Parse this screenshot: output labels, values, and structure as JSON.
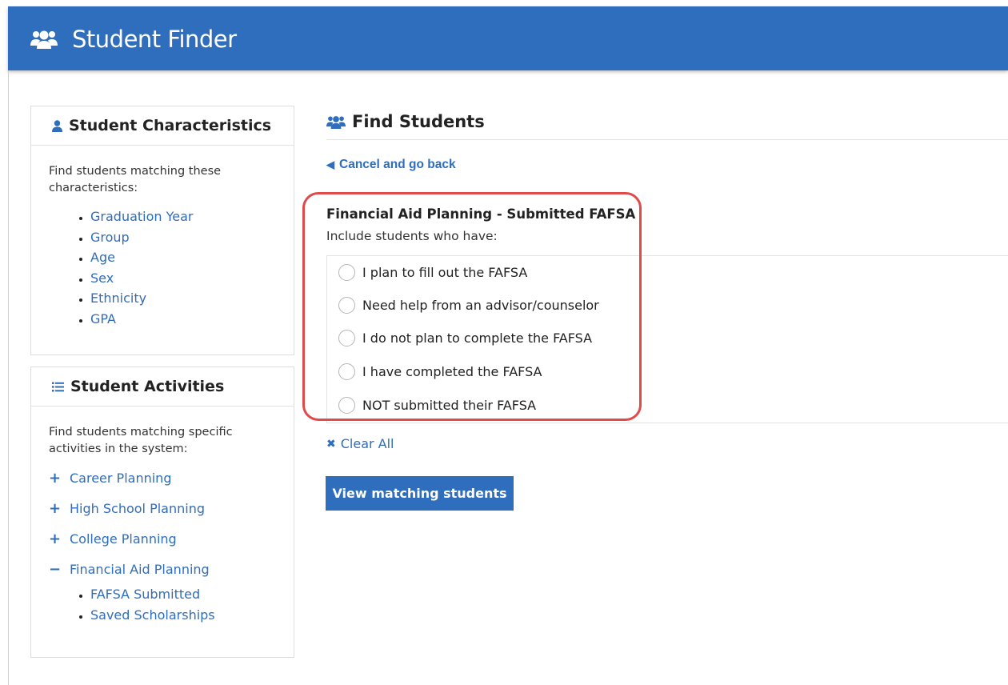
{
  "header": {
    "title": "Student Finder",
    "icon": "users-icon",
    "color": "#2f6dbd"
  },
  "characteristics": {
    "title": "Student Characteristics",
    "description": "Find students matching these characteristics:",
    "items": [
      "Graduation Year",
      "Group",
      "Age",
      "Sex",
      "Ethnicity",
      "GPA"
    ]
  },
  "activities": {
    "title": "Student Activities",
    "description": "Find students matching specific activities in the system:",
    "items": [
      {
        "sign": "+",
        "label": "Career Planning"
      },
      {
        "sign": "+",
        "label": "High School Planning"
      },
      {
        "sign": "+",
        "label": "College Planning"
      },
      {
        "sign": "−",
        "label": "Financial Aid Planning"
      }
    ],
    "sub_items": [
      "FAFSA Submitted",
      "Saved Scholarships"
    ]
  },
  "main": {
    "title": "Find Students",
    "back_link": "Cancel and go back",
    "filter_title": "Financial Aid Planning - Submitted FAFSA",
    "filter_sub": "Include students who have:",
    "options": [
      "I plan to fill out the FAFSA",
      "Need help from an advisor/counselor",
      "I do not plan to complete the FAFSA",
      "I have completed the FAFSA",
      "NOT submitted their FAFSA"
    ],
    "clear_all": "Clear All",
    "view_button": "View matching students"
  },
  "colors": {
    "accent": "#2f6dbd",
    "highlight": "#e04a4a"
  }
}
